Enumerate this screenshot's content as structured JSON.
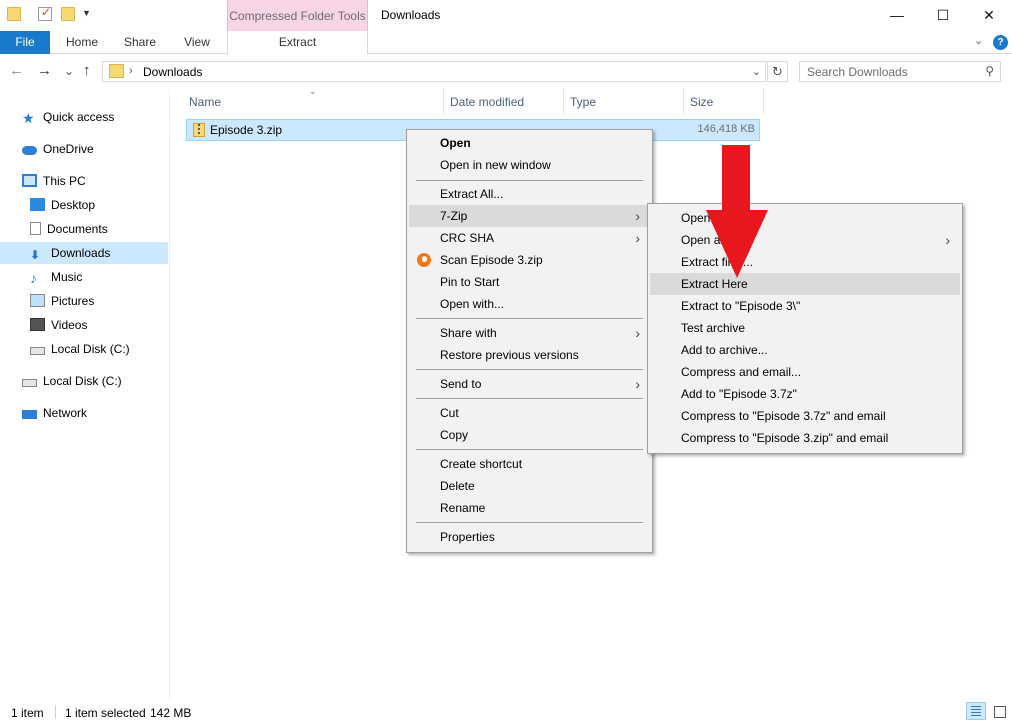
{
  "titlebar": {
    "contextual_tab_group": "Compressed Folder Tools",
    "window_title": "Downloads",
    "minimize": "—",
    "maximize": "☐",
    "close": "✕"
  },
  "ribbon": {
    "tabs": [
      "File",
      "Home",
      "Share",
      "View",
      "Extract"
    ]
  },
  "address": {
    "back": "←",
    "forward": "→",
    "recent": "⌄",
    "up": "↑",
    "path": "Downloads",
    "search_placeholder": "Search Downloads"
  },
  "nav": {
    "items": [
      {
        "label": "Quick access",
        "icon": "quick-access-icon"
      },
      {
        "label": "OneDrive",
        "icon": "onedrive-icon"
      },
      {
        "label": "This PC",
        "icon": "this-pc-icon"
      },
      {
        "label": "Desktop",
        "icon": "desktop-icon"
      },
      {
        "label": "Documents",
        "icon": "documents-icon"
      },
      {
        "label": "Downloads",
        "icon": "downloads-icon",
        "selected": true
      },
      {
        "label": "Music",
        "icon": "music-icon"
      },
      {
        "label": "Pictures",
        "icon": "pictures-icon"
      },
      {
        "label": "Videos",
        "icon": "videos-icon"
      },
      {
        "label": "Local Disk (C:)",
        "icon": "disk-icon"
      },
      {
        "label": "Local Disk (C:)",
        "icon": "disk-icon"
      },
      {
        "label": "Network",
        "icon": "network-icon"
      }
    ]
  },
  "columns": [
    "Name",
    "Date modified",
    "Type",
    "Size"
  ],
  "files": [
    {
      "name": "Episode 3.zip",
      "size": "146,418 KB"
    }
  ],
  "context_menu": {
    "items": [
      "Open",
      "Open in new window",
      "Extract All...",
      "7-Zip",
      "CRC SHA",
      "Scan Episode 3.zip",
      "Pin to Start",
      "Open with...",
      "Share with",
      "Restore previous versions",
      "Send to",
      "Cut",
      "Copy",
      "Create shortcut",
      "Delete",
      "Rename",
      "Properties"
    ]
  },
  "submenu_7zip": {
    "items": [
      "Open archive",
      "Open archive",
      "Extract files...",
      "Extract Here",
      "Extract to \"Episode 3\\\"",
      "Test archive",
      "Add to archive...",
      "Compress and email...",
      "Add to \"Episode 3.7z\"",
      "Compress to \"Episode 3.7z\" and email",
      "Compress to \"Episode 3.zip\" and email"
    ],
    "highlighted": "Extract Here"
  },
  "annotation": {
    "arrow_color": "#e8171e"
  },
  "status": {
    "item_count": "1 item",
    "selected": "1 item selected",
    "selected_size": "142 MB"
  },
  "colors": {
    "file_tab": "#1979ca",
    "contextual_tab": "#f7d4e6",
    "selection": "#cce8ff"
  }
}
